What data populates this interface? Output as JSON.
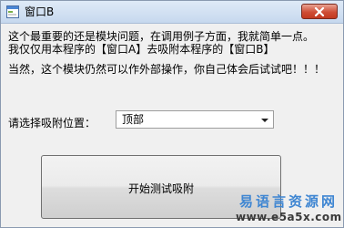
{
  "window": {
    "title": "窗口B"
  },
  "messages": {
    "line1": "这个最重要的还是模块问题，在调用例子方面，我就简单一点。",
    "line2": "我仅仅用本程序的【窗口A】去吸附本程序的【窗口B】",
    "line3": "当然，这个模块仍然可以作外部操作，你自己体会后试试吧！！！"
  },
  "position": {
    "label": "请选择吸附位置：",
    "selected": "顶部"
  },
  "actions": {
    "start_label": "开始测试吸附"
  },
  "watermark": {
    "brand": "易语言资源网",
    "url": "www.e5a5x.com"
  },
  "colors": {
    "close_button": "#c9452d",
    "watermark_blue": "#3f86d2"
  },
  "icons": {
    "app": "window-app-icon",
    "close": "close-icon",
    "dropdown": "chevron-down-icon"
  }
}
